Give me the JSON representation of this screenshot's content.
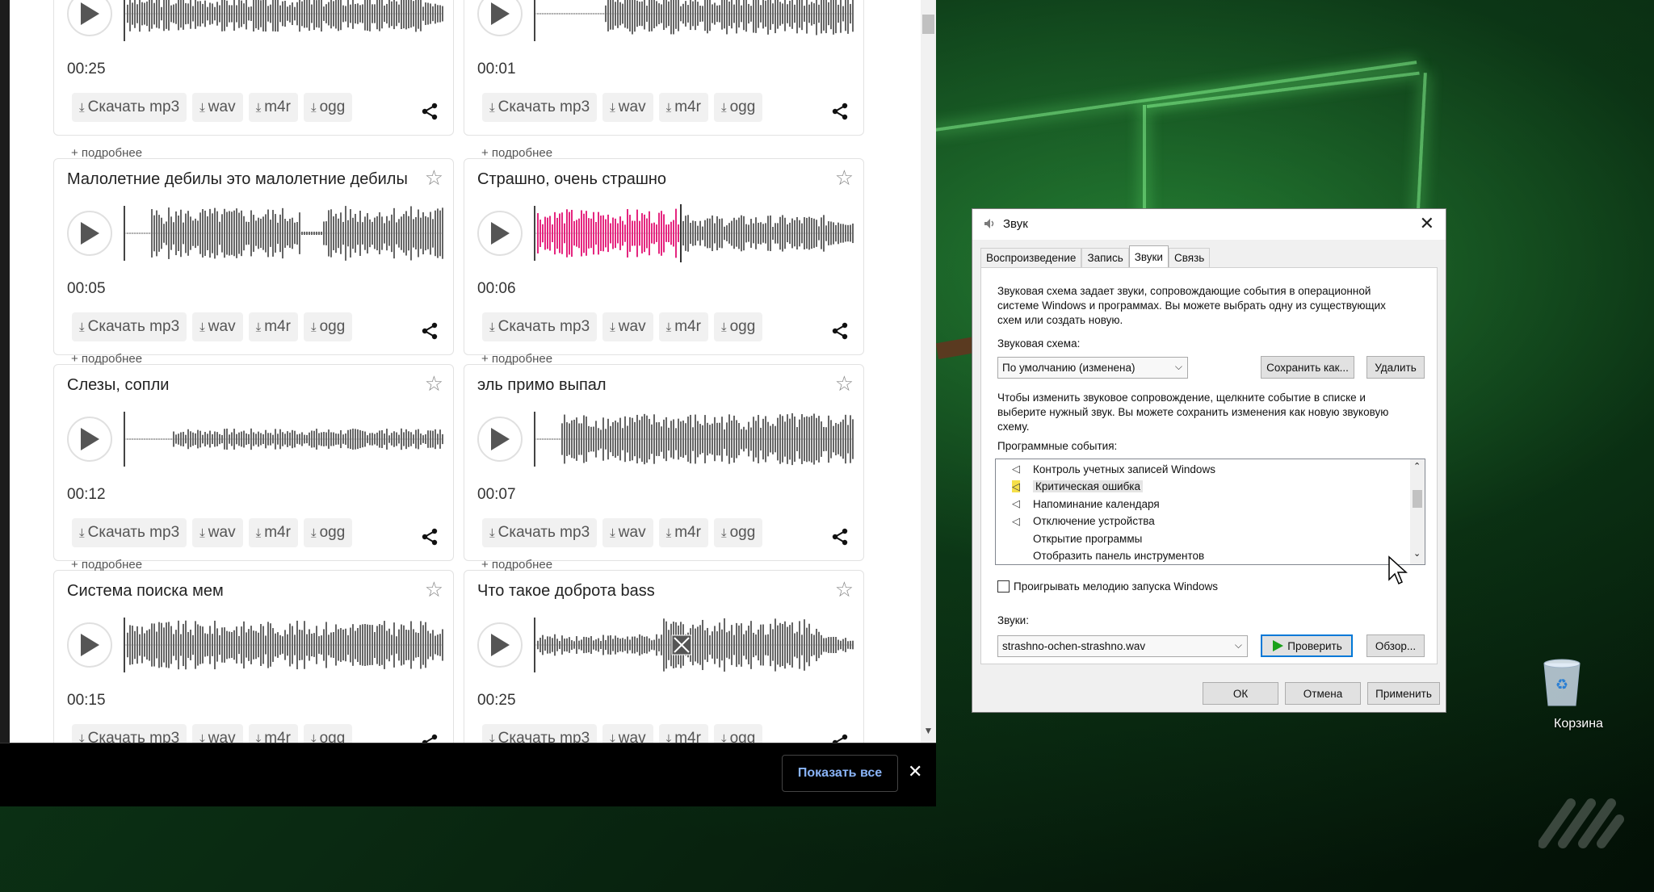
{
  "browser": {
    "cards": [
      {
        "title": "",
        "duration": "00:25",
        "more": "+ подробнее"
      },
      {
        "title": "",
        "duration": "00:01",
        "more": "+ подробнее"
      },
      {
        "title": "Малолетние дебилы это малолетние дебилы",
        "duration": "00:05",
        "more": "+ подробнее"
      },
      {
        "title": "Страшно, очень страшно",
        "duration": "00:06",
        "more": "+ подробнее"
      },
      {
        "title": "Слезы, сопли",
        "duration": "00:12",
        "more": "+ подробнее"
      },
      {
        "title": "эль примо выпал",
        "duration": "00:07",
        "more": "+ подробнее"
      },
      {
        "title": "Система поиска мем",
        "duration": "00:15",
        "more": ""
      },
      {
        "title": "Что такое доброта bass",
        "duration": "00:25",
        "more": ""
      }
    ],
    "buttons": {
      "mp3": "Скачать mp3",
      "wav": "wav",
      "m4r": "m4r",
      "ogg": "ogg"
    },
    "icons": {
      "play": "play-icon",
      "star": "star-icon",
      "download": "download-icon",
      "share": "share-icon"
    },
    "highlight_color": "#e5267f",
    "wave_color": "#666666"
  },
  "download_bar": {
    "show_all": "Показать все",
    "close": "✕"
  },
  "sound_dialog": {
    "title": "Звук",
    "close": "✕",
    "tabs": [
      "Воспроизведение",
      "Запись",
      "Звуки",
      "Связь"
    ],
    "active_tab": "Звуки",
    "intro_line1": "Звуковая схема задает звуки, сопровождающие события в операционной",
    "intro_line2": "системе Windows и программах. Вы можете выбрать одну из существующих",
    "intro_line3": "схем или создать новую.",
    "scheme_label": "Звуковая схема:",
    "scheme_value": "По умолчанию (изменена)",
    "save_as": "Сохранить как...",
    "delete": "Удалить",
    "change_line1": "Чтобы изменить звуковое сопровождение, щелкните событие в списке и",
    "change_line2": "выберите нужный звук. Вы можете сохранить изменения как новую звуковую",
    "change_line3": "схему.",
    "events_label": "Программные события:",
    "events": [
      {
        "label": "Контроль учетных записей Windows",
        "icon": true,
        "selected": false
      },
      {
        "label": "Критическая ошибка",
        "icon": true,
        "selected": true
      },
      {
        "label": "Напоминание календаря",
        "icon": true,
        "selected": false
      },
      {
        "label": "Отключение устройства",
        "icon": true,
        "selected": false
      },
      {
        "label": "Открытие программы",
        "icon": false,
        "selected": false
      },
      {
        "label": "Отобразить панель инструментов",
        "icon": false,
        "selected": false
      }
    ],
    "startup_checkbox": "Проигрывать мелодию запуска Windows",
    "startup_checked": false,
    "sounds_label": "Звуки:",
    "sound_file": "strashno-ochen-strashno.wav",
    "test": "Проверить",
    "browse": "Обзор...",
    "ok": "ОК",
    "cancel": "Отмена",
    "apply": "Применить"
  },
  "desktop": {
    "recycle_bin": "Корзина"
  }
}
